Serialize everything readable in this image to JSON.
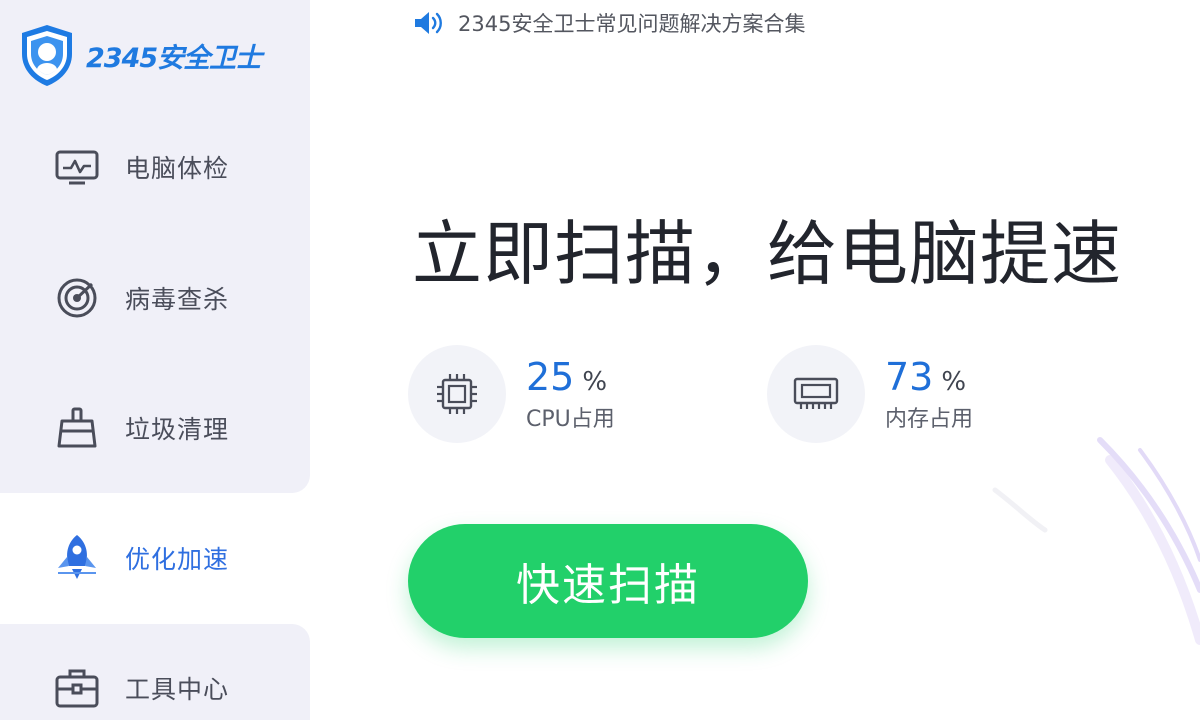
{
  "app": {
    "brand_name": "2345安全卫士",
    "accent_color": "#1f7ae0",
    "brand_icon": "shield-logo-icon"
  },
  "sidebar": {
    "items": [
      {
        "label": "电脑体检",
        "icon": "monitor-icon",
        "active": false
      },
      {
        "label": "病毒查杀",
        "icon": "target-icon",
        "active": false
      },
      {
        "label": "垃圾清理",
        "icon": "broom-icon",
        "active": false
      },
      {
        "label": "优化加速",
        "icon": "rocket-icon",
        "active": true
      },
      {
        "label": "工具中心",
        "icon": "toolbox-icon",
        "active": false
      }
    ]
  },
  "notice": {
    "icon": "speaker-icon",
    "text": "2345安全卫士常见问题解决方案合集"
  },
  "main": {
    "headline": "立即扫描，给电脑提速",
    "stats": [
      {
        "value": "25",
        "unit": "%",
        "label": "CPU占用",
        "icon": "cpu-icon"
      },
      {
        "value": "73",
        "unit": "%",
        "label": "内存占用",
        "icon": "memory-icon"
      }
    ],
    "scan_button": "快速扫描",
    "scan_button_color": "#22d06a"
  }
}
